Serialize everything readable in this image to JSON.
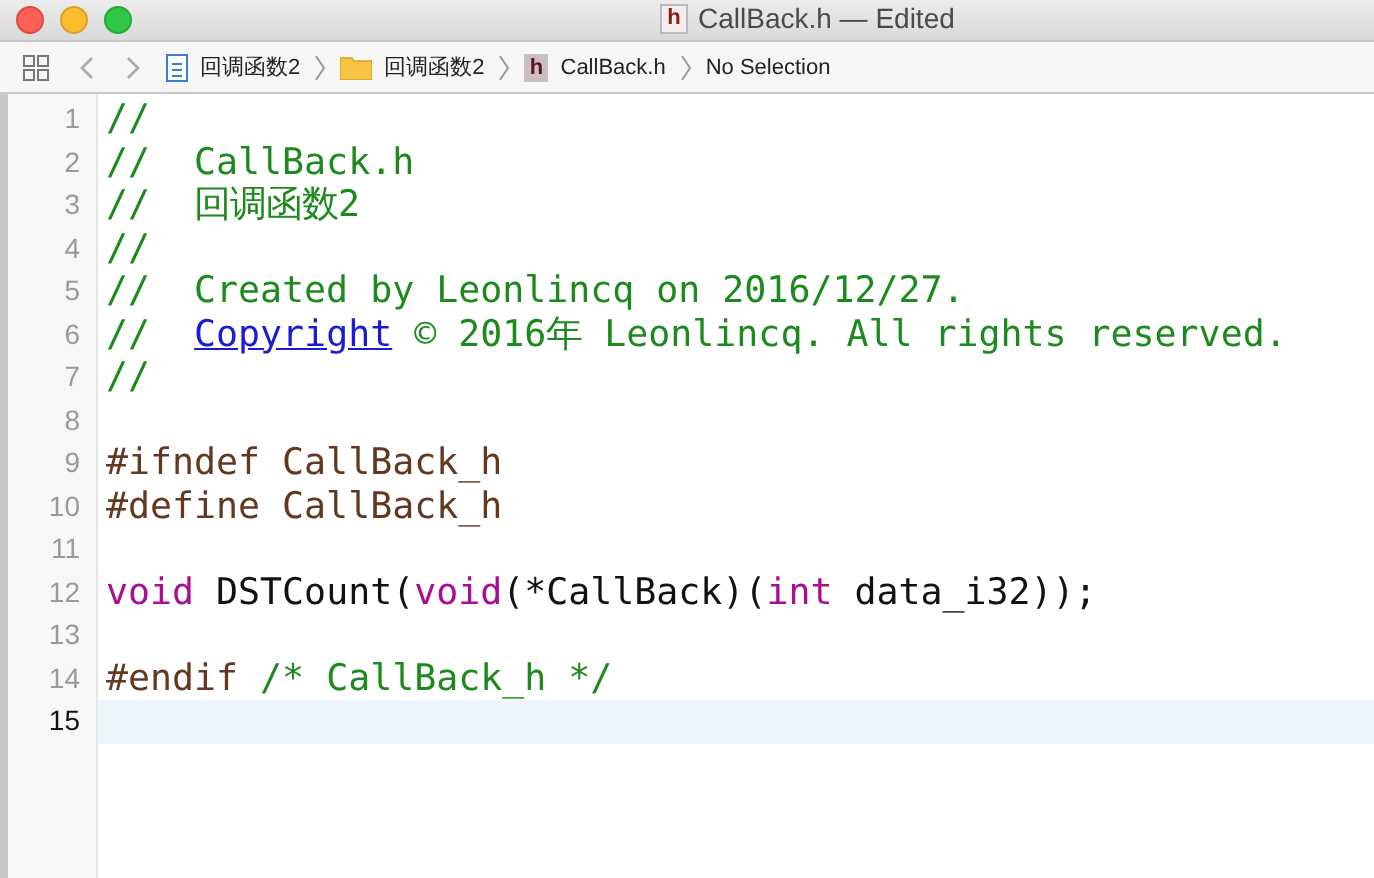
{
  "window": {
    "icon": "h",
    "title": "CallBack.h — Edited"
  },
  "jump_bar": [
    {
      "kind": "project",
      "label": "回调函数2"
    },
    {
      "kind": "folder",
      "label": "回调函数2"
    },
    {
      "kind": "header",
      "icon": "h",
      "label": "CallBack.h"
    },
    {
      "kind": "plain",
      "label": "No Selection"
    }
  ],
  "editor": {
    "lines": [
      {
        "number": "1",
        "current": false,
        "tokens": [
          {
            "kind": "comment",
            "text": "//"
          }
        ]
      },
      {
        "number": "2",
        "current": false,
        "tokens": [
          {
            "kind": "comment",
            "text": "//  CallBack.h"
          }
        ]
      },
      {
        "number": "3",
        "current": false,
        "tokens": [
          {
            "kind": "comment",
            "text": "//  回调函数2"
          }
        ]
      },
      {
        "number": "4",
        "current": false,
        "tokens": [
          {
            "kind": "comment",
            "text": "//"
          }
        ]
      },
      {
        "number": "5",
        "current": false,
        "tokens": [
          {
            "kind": "comment",
            "text": "//  Created by Leonlincq on 2016/12/27."
          }
        ]
      },
      {
        "number": "6",
        "current": false,
        "tokens": [
          {
            "kind": "comment",
            "text": "//  "
          },
          {
            "kind": "link",
            "text": "Copyright"
          },
          {
            "kind": "comment",
            "text": " © 2016年 Leonlincq. All rights reserved."
          }
        ]
      },
      {
        "number": "7",
        "current": false,
        "tokens": [
          {
            "kind": "comment",
            "text": "//"
          }
        ]
      },
      {
        "number": "8",
        "current": false
      },
      {
        "number": "9",
        "current": false,
        "tokens": [
          {
            "kind": "preproc",
            "text": "#ifndef CallBack_h"
          }
        ]
      },
      {
        "number": "10",
        "current": false,
        "tokens": [
          {
            "kind": "preproc",
            "text": "#define CallBack_h"
          }
        ]
      },
      {
        "number": "11",
        "current": false
      },
      {
        "number": "12",
        "current": false,
        "tokens": [
          {
            "kind": "keyword",
            "text": "void"
          },
          {
            "kind": "plain",
            "text": " DSTCount("
          },
          {
            "kind": "keyword",
            "text": "void"
          },
          {
            "kind": "plain",
            "text": "(*CallBack)("
          },
          {
            "kind": "keyword",
            "text": "int"
          },
          {
            "kind": "plain",
            "text": " data_i32));"
          }
        ]
      },
      {
        "number": "13",
        "current": false
      },
      {
        "number": "14",
        "current": false,
        "tokens": [
          {
            "kind": "preproc",
            "text": "#endif "
          },
          {
            "kind": "comment",
            "text": "/* CallBack_h */"
          }
        ]
      },
      {
        "number": "15",
        "current": true
      }
    ]
  }
}
